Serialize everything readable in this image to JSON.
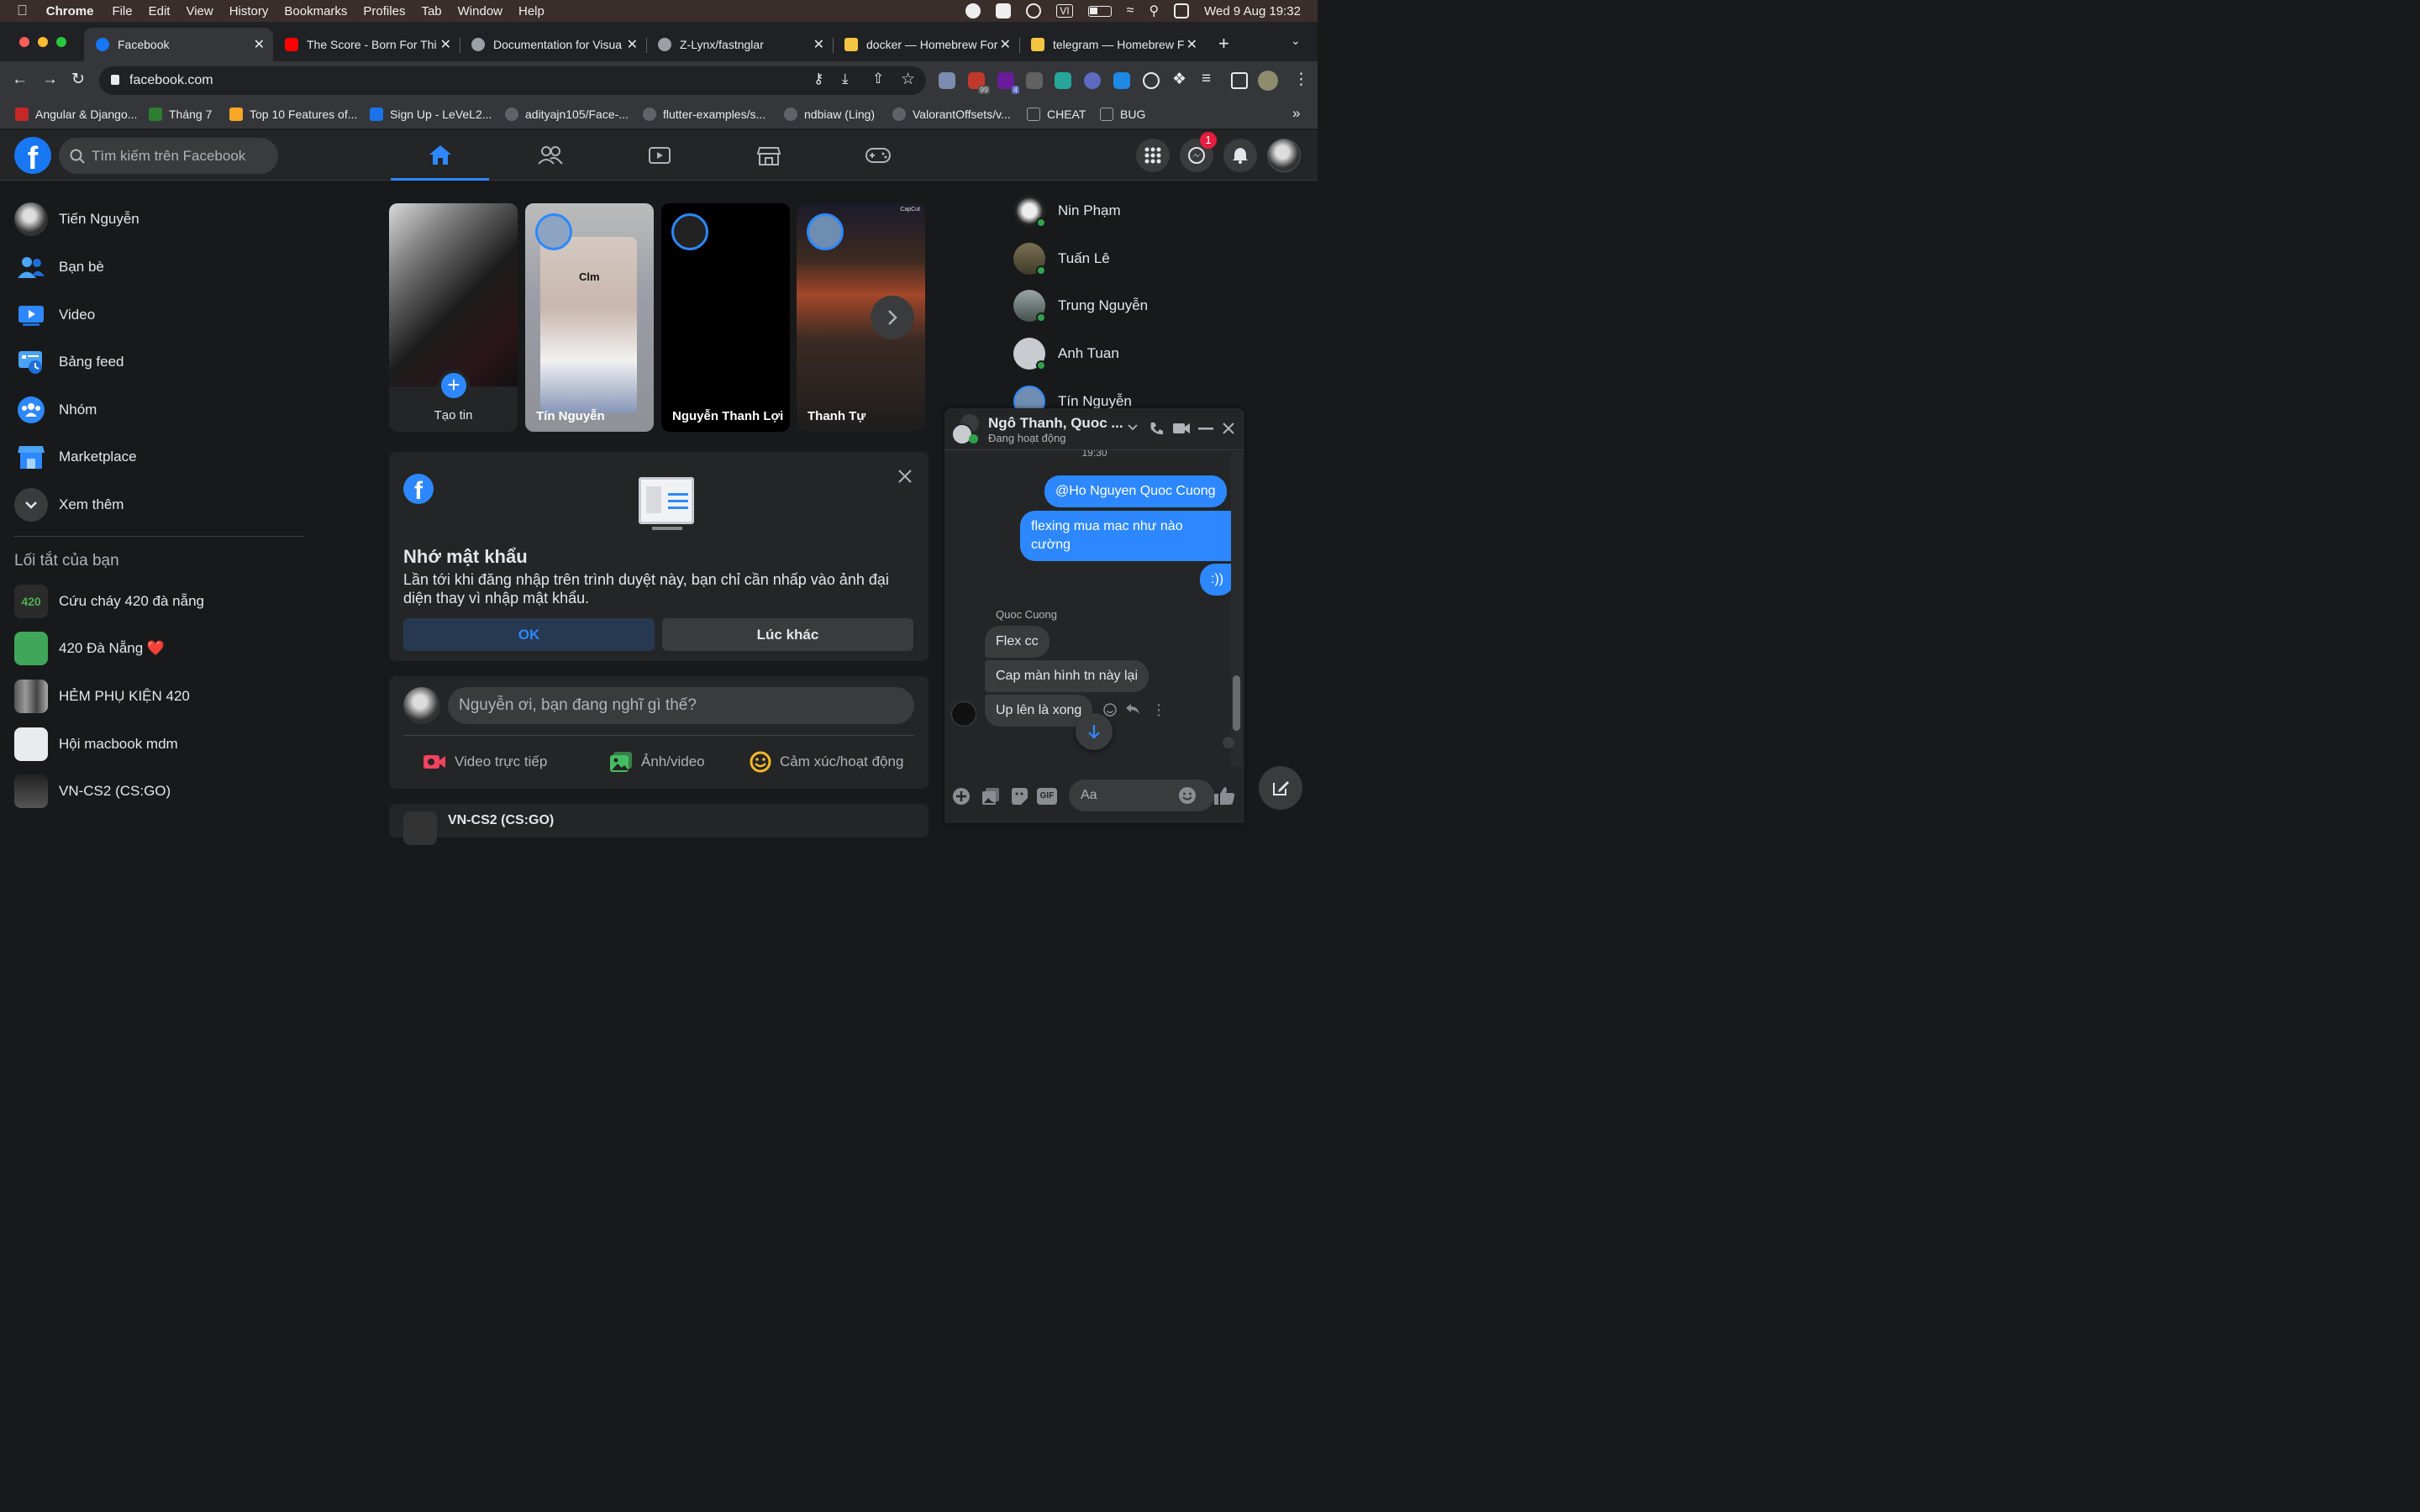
{
  "menubar": {
    "app": "Chrome",
    "items": [
      "File",
      "Edit",
      "View",
      "History",
      "Bookmarks",
      "Profiles",
      "Tab",
      "Window",
      "Help"
    ],
    "clock": "Wed 9 Aug  19:32",
    "vi": "VI"
  },
  "tabs": [
    {
      "title": "Facebook",
      "color": "#1877f2"
    },
    {
      "title": "The Score - Born For Thi",
      "color": "#ff0000"
    },
    {
      "title": "Documentation for Visua",
      "color": "#9aa0a6"
    },
    {
      "title": "Z-Lynx/fastnglar",
      "color": "#9aa0a6"
    },
    {
      "title": "docker — Homebrew For",
      "color": "#f4c542"
    },
    {
      "title": "telegram — Homebrew F",
      "color": "#f4c542"
    }
  ],
  "address": {
    "url": "facebook.com"
  },
  "extensions": {
    "badge1": "99",
    "badge2": "4"
  },
  "bookmarks": [
    {
      "label": "Angular & Django...",
      "color": "#c62828"
    },
    {
      "label": "Tháng 7",
      "color": "#2e7d32"
    },
    {
      "label": "Top 10 Features of...",
      "color": "#f9a825"
    },
    {
      "label": "Sign Up - LeVeL2...",
      "color": "#1a73e8"
    },
    {
      "label": "adityajn105/Face-...",
      "color": "#5f6368"
    },
    {
      "label": "flutter-examples/s...",
      "color": "#5f6368"
    },
    {
      "label": "ndbiaw (Ling)",
      "color": "#5f6368"
    },
    {
      "label": "ValorantOffsets/v...",
      "color": "#5f6368"
    },
    {
      "label": "CHEAT",
      "color": "#9aa0a6"
    },
    {
      "label": "BUG",
      "color": "#9aa0a6"
    }
  ],
  "fb": {
    "search_placeholder": "Tìm kiếm trên Facebook",
    "notif_count": "1"
  },
  "sidebar": {
    "items": [
      {
        "label": "Tiến Nguyễn"
      },
      {
        "label": "Bạn bè"
      },
      {
        "label": "Video"
      },
      {
        "label": "Bảng feed"
      },
      {
        "label": "Nhóm"
      },
      {
        "label": "Marketplace"
      },
      {
        "label": "Xem thêm"
      }
    ],
    "shortcuts_title": "Lối tắt của bạn",
    "shortcuts": [
      {
        "label": "Cứu cháy 420 đà nẵng"
      },
      {
        "label": "420 Đà Nẵng ❤️"
      },
      {
        "label": "HẺM PHỤ KIỆN 420"
      },
      {
        "label": "Hội macbook mdm"
      },
      {
        "label": "VN-CS2 (CS:GO)"
      }
    ]
  },
  "stories": {
    "create_label": "Tạo tin",
    "items": [
      {
        "name": "Tín Nguyễn",
        "caption": "Clm"
      },
      {
        "name": "Nguyễn Thanh Lợi"
      },
      {
        "name": "Thanh Tự"
      }
    ],
    "capcut": "CapCut"
  },
  "password_card": {
    "title": "Nhớ mật khẩu",
    "body": "Lần tới khi đăng nhập trên trình duyệt này, bạn chỉ cần nhấp vào ảnh đại diện thay vì nhập mật khẩu.",
    "ok": "OK",
    "later": "Lúc khác"
  },
  "composer": {
    "placeholder": "Nguyễn ơi, bạn đang nghĩ gì thế?",
    "live": "Video trực tiếp",
    "photo": "Ảnh/video",
    "feeling": "Cảm xúc/hoạt động"
  },
  "next_post": {
    "title": "VN-CS2 (CS:GO)"
  },
  "contacts": [
    {
      "name": "Nin Phạm"
    },
    {
      "name": "Tuấn Lê"
    },
    {
      "name": "Trung Nguyễn"
    },
    {
      "name": "Anh Tuan"
    },
    {
      "name": "Tín Nguyễn"
    }
  ],
  "chat": {
    "name": "Ngô Thanh, Quoc ...",
    "status": "Đang hoạt động",
    "time": "19:30",
    "messages_me": [
      "@Ho Nguyen Quoc Cuong",
      "flexing mua mac như nào cường",
      ":))"
    ],
    "sender": "Quoc Cuong",
    "messages_them": [
      "Flex cc",
      "Cap màn hình tn này lại",
      "Up lên là xong"
    ],
    "input_placeholder": "Aa"
  }
}
